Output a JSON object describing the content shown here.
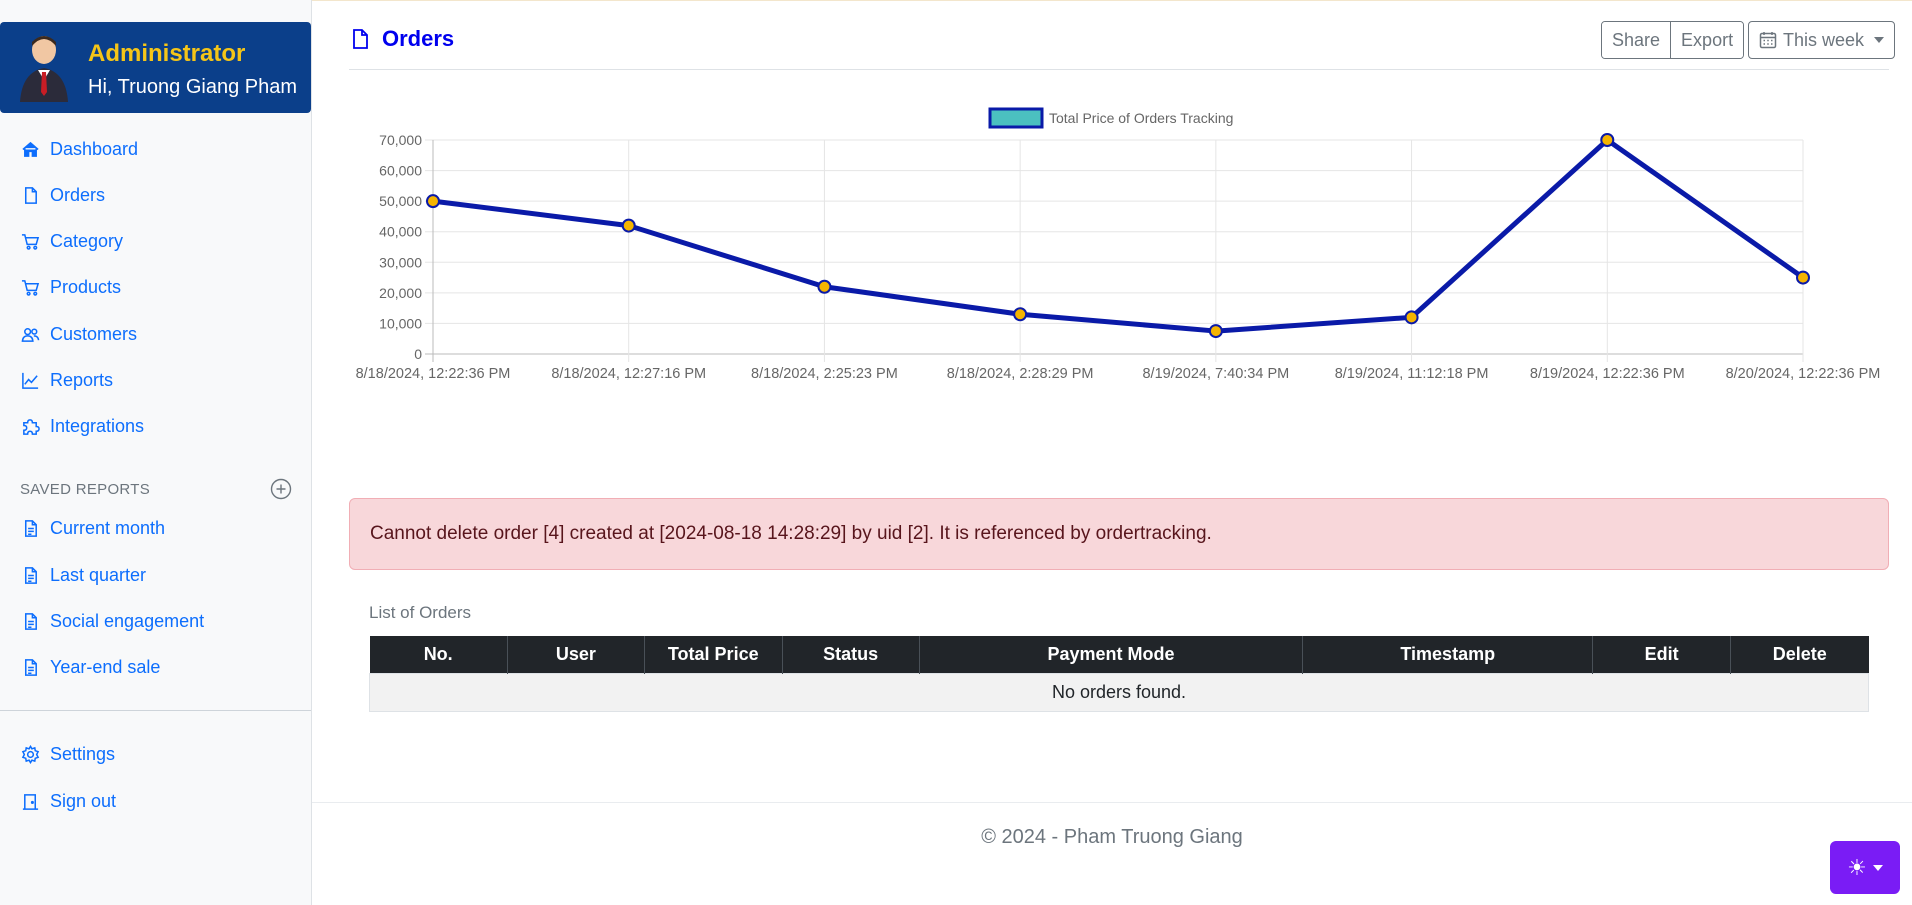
{
  "profile": {
    "role": "Administrator",
    "greeting": "Hi, Truong Giang Pham"
  },
  "nav": [
    {
      "label": "Dashboard",
      "icon": "home-icon"
    },
    {
      "label": "Orders",
      "icon": "file-icon"
    },
    {
      "label": "Category",
      "icon": "cart-icon"
    },
    {
      "label": "Products",
      "icon": "cart-icon"
    },
    {
      "label": "Customers",
      "icon": "users-icon"
    },
    {
      "label": "Reports",
      "icon": "chart-line-icon"
    },
    {
      "label": "Integrations",
      "icon": "puzzle-icon"
    }
  ],
  "saved_reports": {
    "heading": "SAVED REPORTS",
    "items": [
      "Current month",
      "Last quarter",
      "Social engagement",
      "Year-end sale"
    ]
  },
  "bottom_nav": [
    {
      "label": "Settings",
      "icon": "gear-icon"
    },
    {
      "label": "Sign out",
      "icon": "door-icon"
    }
  ],
  "header": {
    "title": "Orders",
    "share_label": "Share",
    "export_label": "Export",
    "range_label": "This week"
  },
  "chart_data": {
    "type": "line",
    "title": "",
    "legend": "Total Price of Orders Tracking",
    "legend_placement": "top-center",
    "x": [
      "8/18/2024, 12:22:36 PM",
      "8/18/2024, 12:27:16 PM",
      "8/18/2024, 2:25:23 PM",
      "8/18/2024, 2:28:29 PM",
      "8/19/2024, 7:40:34 PM",
      "8/19/2024, 11:12:18 PM",
      "8/19/2024, 12:22:36 PM",
      "8/20/2024, 12:22:36 PM"
    ],
    "series": [
      {
        "name": "Total Price of Orders Tracking",
        "values": [
          50000,
          42000,
          22000,
          13000,
          7500,
          12000,
          70000,
          25000
        ]
      }
    ],
    "ylim": [
      0,
      70000
    ],
    "yticks": [
      "0",
      "10,000",
      "20,000",
      "30,000",
      "40,000",
      "50,000",
      "60,000",
      "70,000"
    ],
    "grid": true,
    "colors": {
      "line": "#0a1aa8",
      "point_fill": "#f5b400",
      "legend_fill": "#4bc0c0"
    }
  },
  "alert": {
    "message": "Cannot delete order [4] created at [2024-08-18 14:28:29] by uid [2]. It is referenced by ordertracking."
  },
  "orders_table": {
    "caption": "List of Orders",
    "columns": [
      "No.",
      "User",
      "Total Price",
      "Status",
      "Payment Mode",
      "Timestamp",
      "Edit",
      "Delete"
    ],
    "empty_message": "No orders found."
  },
  "footer": {
    "text": "© 2024 - Pham Truong Giang"
  },
  "theme_toggle": {
    "icon": "sun-icon",
    "color": "#7a1cf5"
  }
}
